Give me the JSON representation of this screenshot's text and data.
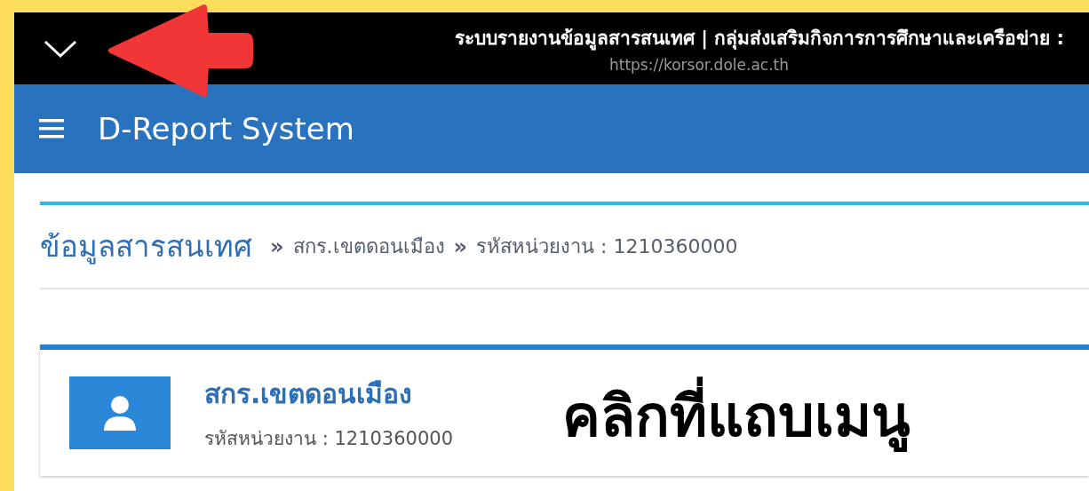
{
  "browser_bar": {
    "page_title": "ระบบรายงานข้อมูลสารสนเทศ | กลุ่มส่งเสริมกิจการการศึกษาและเครือข่าย :",
    "url": "https://korsor.dole.ac.th"
  },
  "app_bar": {
    "title": "D-Report System"
  },
  "breadcrumb": {
    "heading": "ข้อมูลสารสนเทศ",
    "separator": "»",
    "items": [
      "สกร.เขตดอนเมือง",
      "รหัสหน่วยงาน : 1210360000"
    ]
  },
  "unit_card": {
    "name": "สกร.เขตดอนเมือง",
    "code": "รหัสหน่วยงาน : 1210360000"
  },
  "annotation": {
    "text": "คลิกที่แถบเมนู"
  }
}
